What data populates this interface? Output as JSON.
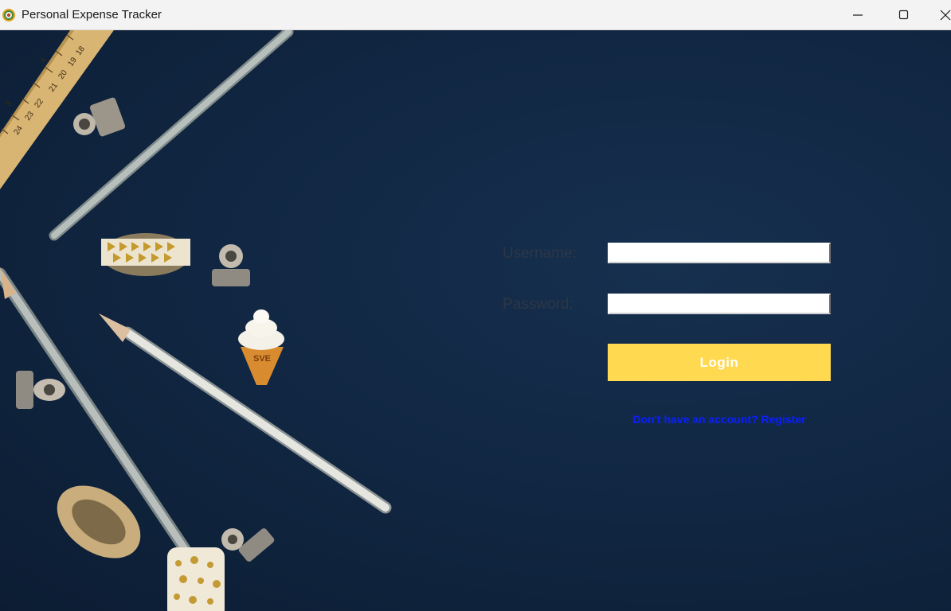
{
  "window": {
    "title": "Personal Expense Tracker",
    "icon": "app-logo-icon",
    "controls": [
      "minimize-icon",
      "maximize-icon",
      "close-icon"
    ]
  },
  "login_form": {
    "username_label": "Username:",
    "username_value": "",
    "password_label": "Password:",
    "password_value": "",
    "login_button": "Login",
    "register_link": "Don't have an account? Register"
  },
  "colors": {
    "background": "#112743",
    "button": "#ffd950",
    "button_text": "#ffffff",
    "link": "#0a1fff",
    "label": "#2d3646"
  },
  "ruler_ticks": [
    "3",
    "4",
    "18",
    "19",
    "20",
    "21",
    "22",
    "23",
    "24"
  ],
  "ice_cream_text": "SVE"
}
